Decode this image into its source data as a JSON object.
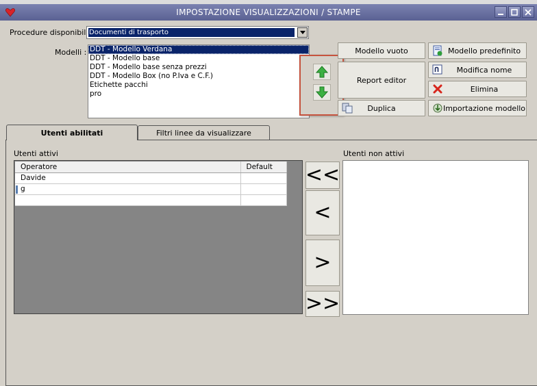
{
  "window": {
    "title": "IMPOSTAZIONE VISUALIZZAZIONI / STAMPE"
  },
  "procedure": {
    "label": "Procedure disponibili :",
    "selected": "Documenti di trasporto"
  },
  "modelli": {
    "label": "Modelli :",
    "items": [
      "DDT - Modello Verdana",
      "DDT - Modello base",
      "DDT - Modello base senza prezzi",
      "DDT - Modello Box (no P.Iva e C.F.)",
      "Etichette pacchi",
      "pro"
    ],
    "selected_index": 0
  },
  "buttons": {
    "modello_vuoto": "Modello vuoto",
    "modello_predefinito": "Modello predefinito",
    "report_editor": "Report editor",
    "modifica_nome": "Modifica nome",
    "elimina": "Elimina",
    "duplica": "Duplica",
    "importazione_modello": "Importazione modello"
  },
  "tabs": [
    {
      "label": "Utenti abilitati",
      "active": true
    },
    {
      "label": "Filtri linee da visualizzare",
      "active": false
    }
  ],
  "utenti_attivi": {
    "label": "Utenti attivi",
    "columns": [
      "Operatore",
      "Default"
    ],
    "rows": [
      {
        "operatore": "Davide",
        "default": ""
      },
      {
        "operatore": "g",
        "default": ""
      },
      {
        "operatore": "",
        "default": ""
      }
    ]
  },
  "utenti_non_attivi": {
    "label": "Utenti non attivi"
  },
  "move_buttons": {
    "all_left": "<<",
    "left": "<",
    "right": ">",
    "all_right": ">>"
  },
  "colors": {
    "titlebar": "#5a6193",
    "selection": "#0a246a",
    "highlight_box": "#c6533e",
    "arrow_green": "#3cb043"
  }
}
